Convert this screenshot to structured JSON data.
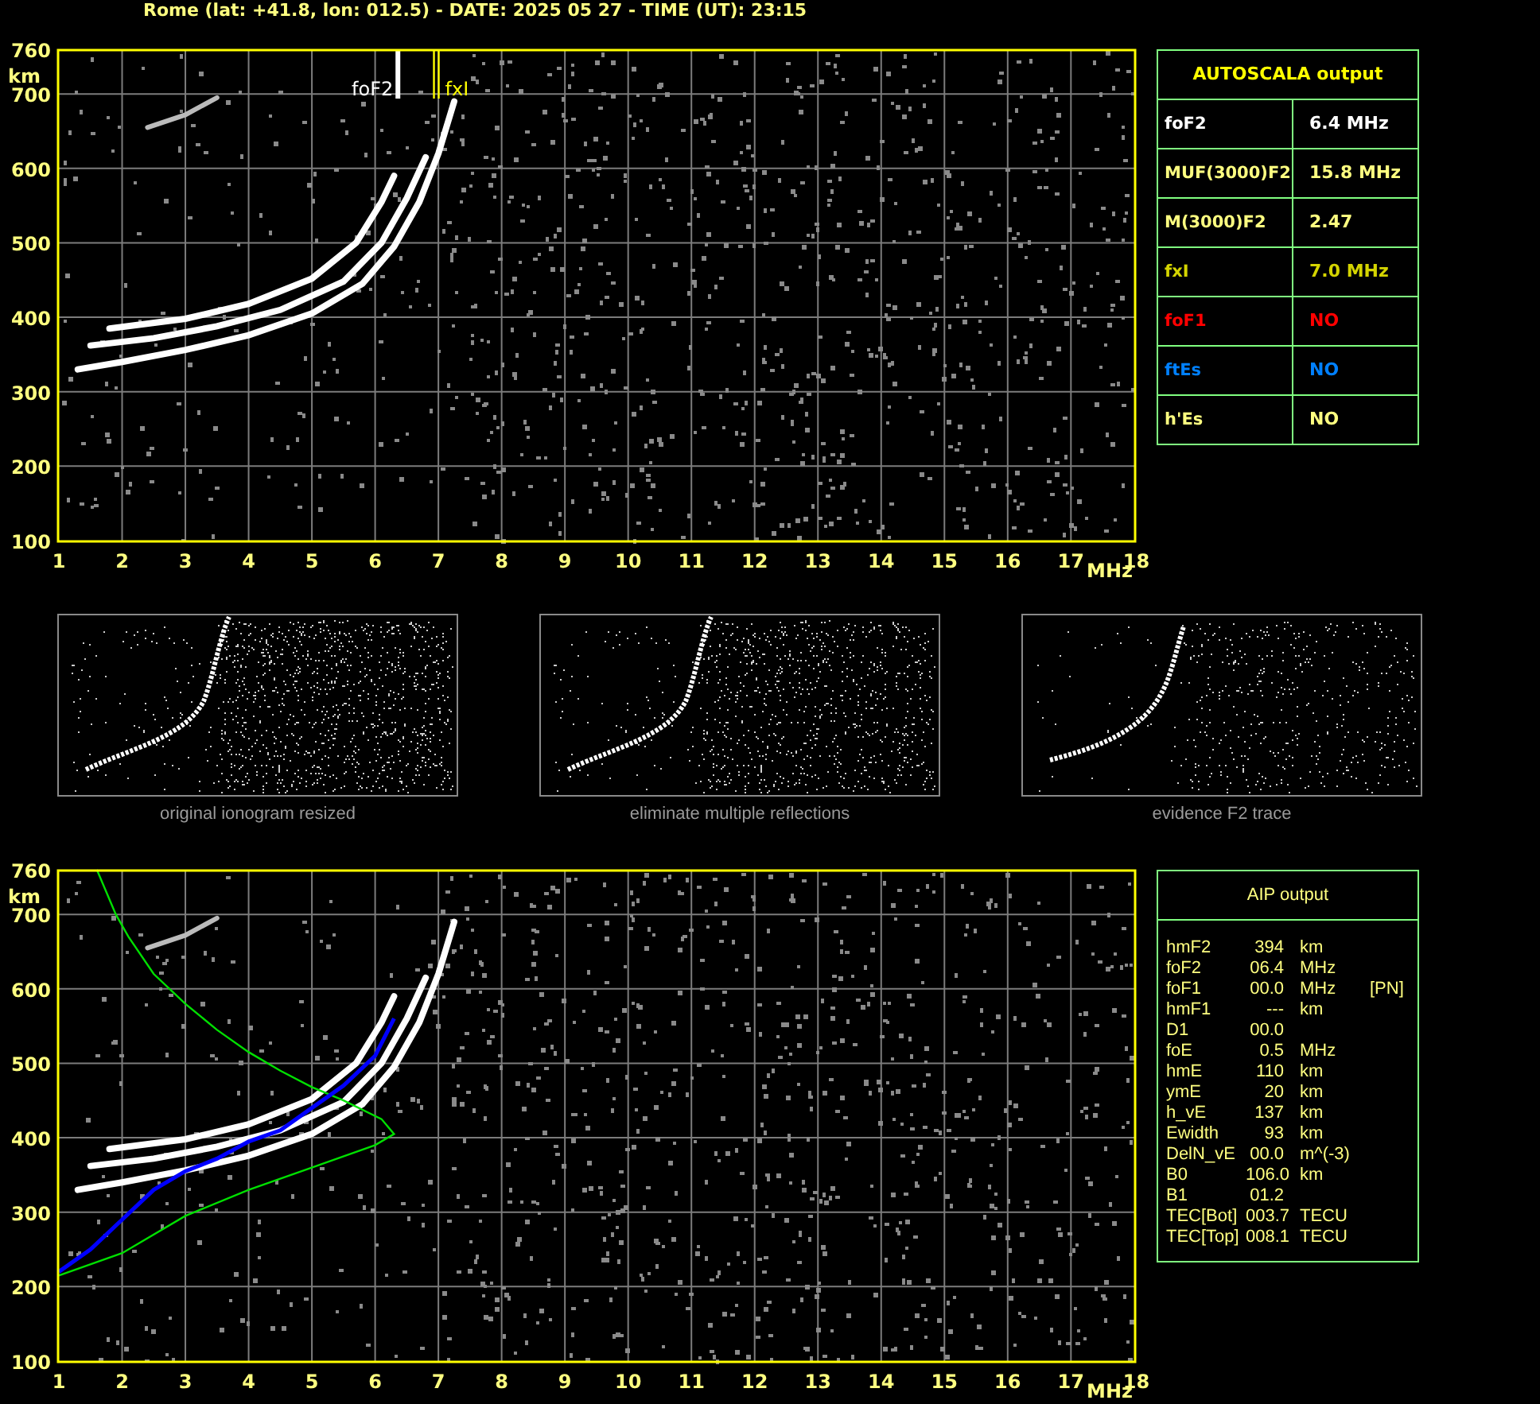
{
  "header": {
    "title": "Rome (lat: +41.8, lon: 012.5) - DATE: 2025 05 27 - TIME (UT): 23:15"
  },
  "top_ionogram": {
    "y_ticks": [
      "760",
      "700",
      "600",
      "500",
      "400",
      "300",
      "200",
      "100"
    ],
    "y_unit": "km",
    "x_ticks": [
      "1",
      "2",
      "3",
      "4",
      "5",
      "6",
      "7",
      "8",
      "9",
      "10",
      "11",
      "12",
      "13",
      "14",
      "15",
      "16",
      "17",
      "18"
    ],
    "x_unit": "MHz",
    "markers": [
      {
        "kind": "critical",
        "label": "foF2"
      },
      {
        "kind": "extraordinary",
        "label": "fxI"
      }
    ]
  },
  "autoscala": {
    "title": "AUTOSCALA output",
    "rows": [
      {
        "kind": "critical",
        "name": "foF2",
        "value": "6.4 MHz"
      },
      {
        "kind": "derived",
        "name": "MUF(3000)F2",
        "value": "15.8 MHz"
      },
      {
        "kind": "derived",
        "name": "M(3000)F2",
        "value": "2.47"
      },
      {
        "kind": "extraordinary",
        "name": "fxI",
        "value": "7.0 MHz"
      },
      {
        "kind": "f1-layer",
        "name": "foF1",
        "value": "NO"
      },
      {
        "kind": "sporadic-e",
        "name": "ftEs",
        "value": "NO"
      },
      {
        "kind": "derived",
        "name": "h'Es",
        "value": "NO"
      }
    ]
  },
  "processing_panels": [
    {
      "kind": "resized",
      "caption": "original ionogram resized"
    },
    {
      "kind": "filtered",
      "caption": "eliminate multiple reflections"
    },
    {
      "kind": "trace",
      "caption": "evidence F2 trace"
    }
  ],
  "bottom_ionogram": {
    "y_ticks": [
      "760",
      "700",
      "600",
      "500",
      "400",
      "300",
      "200",
      "100"
    ],
    "y_unit": "km",
    "x_ticks": [
      "1",
      "2",
      "3",
      "4",
      "5",
      "6",
      "7",
      "8",
      "9",
      "10",
      "11",
      "12",
      "13",
      "14",
      "15",
      "16",
      "17",
      "18"
    ],
    "x_unit": "MHz"
  },
  "aip": {
    "title": "AIP output",
    "rows": [
      {
        "name": "hmF2",
        "value": "394",
        "unit": "km"
      },
      {
        "name": "foF2",
        "value": "06.4",
        "unit": "MHz"
      },
      {
        "name": "foF1",
        "value": "00.0",
        "unit": "MHz",
        "note": "[PN]"
      },
      {
        "name": "hmF1",
        "value": "---",
        "unit": "km"
      },
      {
        "name": "D1",
        "value": "00.0"
      },
      {
        "name": "foE",
        "value": "0.5",
        "unit": "MHz"
      },
      {
        "name": "hmE",
        "value": "110",
        "unit": "km"
      },
      {
        "name": "ymE",
        "value": "20",
        "unit": "km"
      },
      {
        "name": "h_vE",
        "value": "137",
        "unit": "km"
      },
      {
        "name": "Ewidth",
        "value": "93",
        "unit": "km"
      },
      {
        "name": "DelN_vE",
        "value": "00.0",
        "unit": "m^(-3)"
      },
      {
        "name": "B0",
        "value": "106.0",
        "unit": "km"
      },
      {
        "name": "B1",
        "value": "01.2"
      },
      {
        "name": "TEC[Bot]",
        "value": "003.7",
        "unit": "TECU"
      },
      {
        "name": "TEC[Top]",
        "value": "008.1",
        "unit": "TECU"
      }
    ]
  }
}
